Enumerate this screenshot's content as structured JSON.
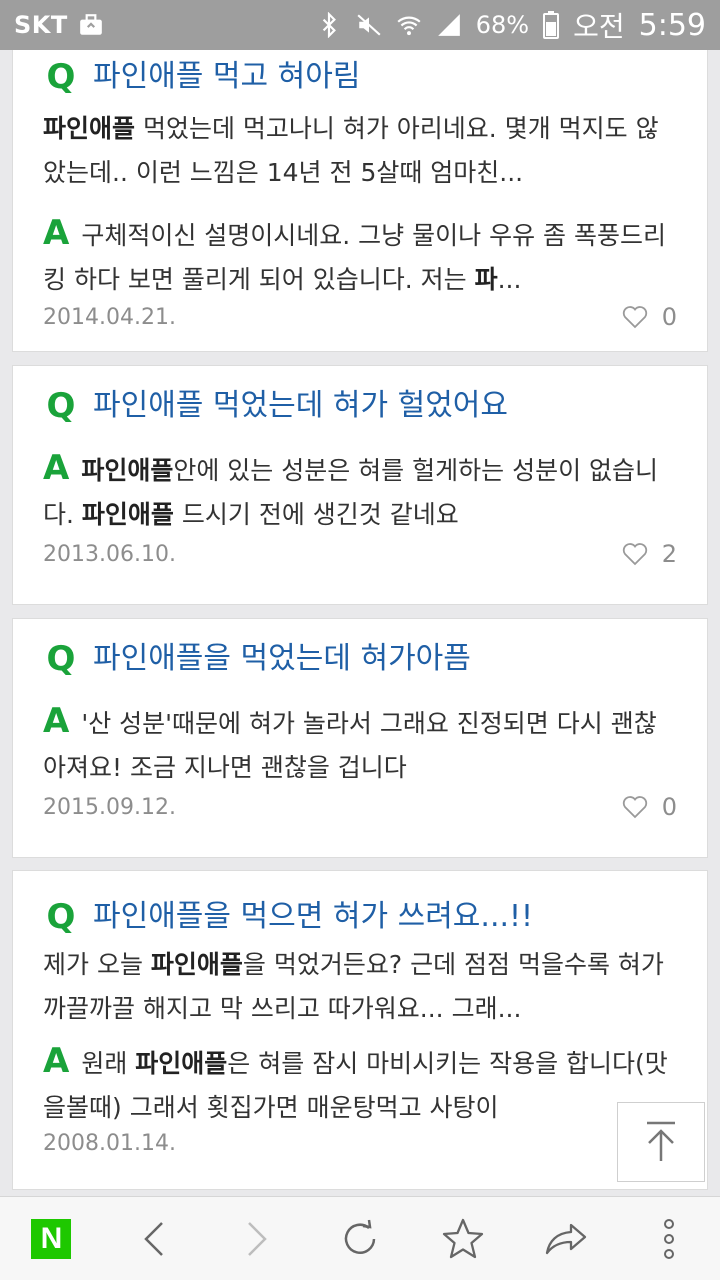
{
  "status": {
    "carrier": "SKT",
    "battery": "68%",
    "ampm": "오전",
    "time": "5:59"
  },
  "results": [
    {
      "q_title": "파인애플 먹고 혀아림",
      "q_text_bold": "파인애플",
      "q_text_rest": " 먹었는데 먹고나니 혀가 아리네요. 몇개 먹지도 않았는데.. 이런 느낌은 14년 전 5살때 엄마친...",
      "a_text_pre": "구체적이신 설명이시네요. 그냥 물이나 우유 좀 폭풍드리킹 하다 보면 풀리게 되어 있습니다. 저는 ",
      "a_text_bold": "파",
      "a_text_post": "...",
      "date": "2014.04.21.",
      "likes": "0"
    },
    {
      "q_title": "파인애플 먹었는데 혀가 헐었어요",
      "a_text_bold": "파인애플",
      "a_text_mid": "안에 있는 성분은 혀를 헐게하는 성분이 없습니다. ",
      "a_text_bold2": "파인애플",
      "a_text_post": " 드시기 전에 생긴것 같네요",
      "date": "2013.06.10.",
      "likes": "2"
    },
    {
      "q_title": "파인애플을 먹었는데 혀가아픔",
      "a_text": "'산 성분'때문에 혀가 놀라서 그래요 진정되면 다시 괜찮아져요! 조금 지나면 괜찮을 겁니다",
      "date": "2015.09.12.",
      "likes": "0"
    },
    {
      "q_title": "파인애플을 먹으면 혀가 쓰려요...!!",
      "q_text_pre": "제가 오늘 ",
      "q_text_bold": "파인애플",
      "q_text_rest": "을 먹었거든요? 근데 점점 먹을수록 혀가 까끌까끌 해지고 막 쓰리고 따가워요... 그래...",
      "a_text_pre": "원래 ",
      "a_text_bold": "파인애플",
      "a_text_post": "은 혀를 잠시 마비시키는 작용을 합니다(맛을볼때) 그래서 횟집가면 매운탕먹고 사탕이",
      "date": "2008.01.14."
    }
  ],
  "labels": {
    "q_mark": "Q",
    "a_mark": "A",
    "naver_logo": "N"
  }
}
